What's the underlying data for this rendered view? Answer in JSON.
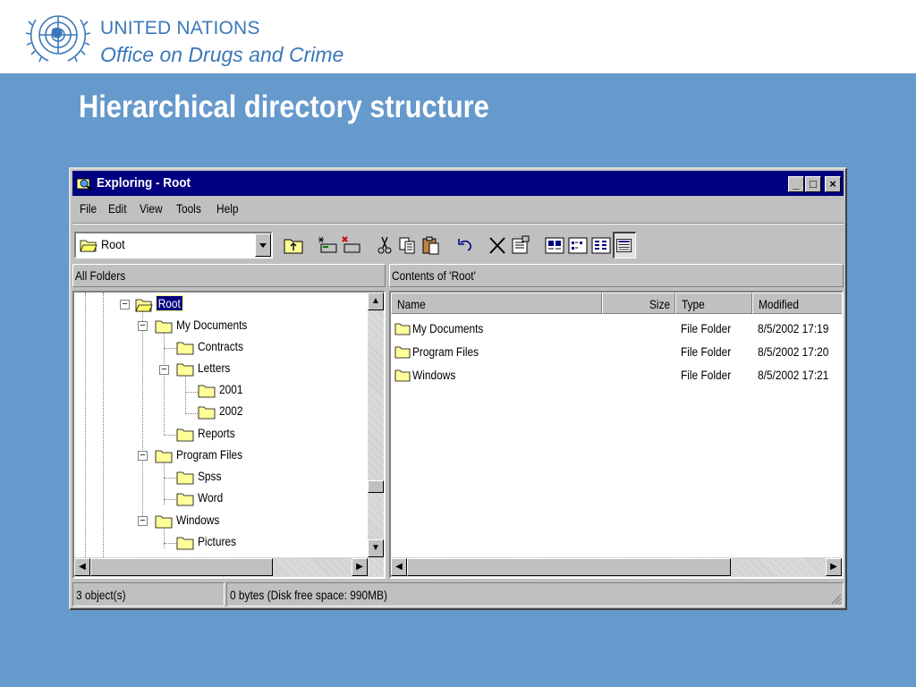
{
  "slide": {
    "org_line1": "UNITED NATIONS",
    "org_line2": "Office on Drugs and Crime",
    "title": "Hierarchical directory structure"
  },
  "window": {
    "title": "Exploring - Root",
    "controls": {
      "minimize": "_",
      "maximize": "□",
      "close": "×"
    },
    "menu": [
      "File",
      "Edit",
      "View",
      "Tools",
      "Help"
    ],
    "address": {
      "value": "Root"
    },
    "toolbar_icons": [
      "up-folder-icon",
      "map-drive-icon",
      "disconnect-drive-icon",
      "cut-icon",
      "copy-icon",
      "paste-icon",
      "undo-icon",
      "delete-icon",
      "properties-icon",
      "large-icons-view-icon",
      "small-icons-view-icon",
      "list-view-icon",
      "details-view-icon"
    ],
    "left_pane_header": "All Folders",
    "right_pane_header": "Contents of 'Root'",
    "tree": [
      {
        "label": "Root",
        "level": 0,
        "expander": "minus",
        "selected": true
      },
      {
        "label": "My Documents",
        "level": 1,
        "expander": "minus"
      },
      {
        "label": "Contracts",
        "level": 2
      },
      {
        "label": "Letters",
        "level": 2,
        "expander": "minus"
      },
      {
        "label": "2001",
        "level": 3
      },
      {
        "label": "2002",
        "level": 3
      },
      {
        "label": "Reports",
        "level": 2
      },
      {
        "label": "Program Files",
        "level": 1,
        "expander": "minus"
      },
      {
        "label": "Spss",
        "level": 2
      },
      {
        "label": "Word",
        "level": 2
      },
      {
        "label": "Windows",
        "level": 1,
        "expander": "minus"
      },
      {
        "label": "Pictures",
        "level": 2
      }
    ],
    "columns": [
      "Name",
      "Size",
      "Type",
      "Modified"
    ],
    "rows": [
      {
        "name": "My Documents",
        "size": "",
        "type": "File Folder",
        "modified": "8/5/2002 17:19"
      },
      {
        "name": "Program Files",
        "size": "",
        "type": "File Folder",
        "modified": "8/5/2002 17:20"
      },
      {
        "name": "Windows",
        "size": "",
        "type": "File Folder",
        "modified": "8/5/2002 17:21"
      }
    ],
    "status": {
      "objects": "3 object(s)",
      "info": "0 bytes (Disk free space: 990MB)"
    }
  },
  "colors": {
    "slide_background": "#6699cc",
    "title_bar": "#000080",
    "window_face": "#c0c0c0",
    "folder_yellow": "#ffff99",
    "un_blue": "#3a78b9"
  }
}
